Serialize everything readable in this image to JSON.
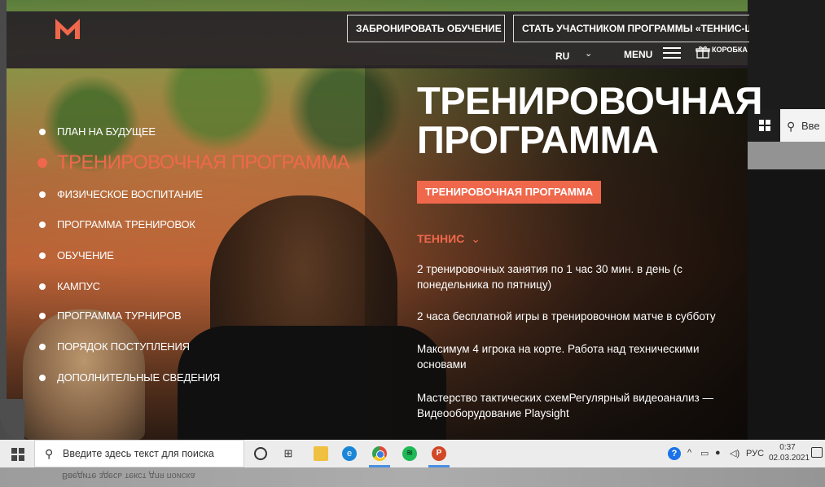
{
  "header": {
    "btn_book": "ЗАБРОНИРОВАТЬ ОБУЧЕНИЕ",
    "btn_member": "СТАТЬ УЧАСТНИКОМ ПРОГРАММЫ «ТЕННИС-ШК",
    "lang": "RU",
    "lang_chevron": "⌄",
    "menu": "MENU",
    "gift_label": "КОРОБКА"
  },
  "nav": {
    "items": [
      "ПЛАН НА БУДУЩЕЕ",
      "ТРЕНИРОВОЧНАЯ ПРОГРАММА",
      "ФИЗИЧЕСКОЕ ВОСПИТАНИЕ",
      "ПРОГРАММА ТРЕНИРОВОК",
      "ОБУЧЕНИЕ",
      "КАМПУС",
      "ПРОГРАММА ТУРНИРОВ",
      "ПОРЯДОК ПОСТУПЛЕНИЯ",
      "ДОПОЛНИТЕЛЬНЫЕ СВЕДЕНИЯ"
    ]
  },
  "content": {
    "title_line1": "ТРЕНИРОВОЧНАЯ",
    "title_line2": "ПРОГРАММА",
    "tag": "ТРЕНИРОВОЧНАЯ ПРОГРАММА",
    "section": "ТЕННИС",
    "section_chevron": "⌄",
    "paragraphs": [
      "2 тренировочных занятия по 1 час 30 мин. в день (с понедельника по пятницу)",
      "2 часа бесплатной игры в тренировочном матче в субботу",
      "Максимум 4 игрока на корте. Работа над техническими основами",
      "Мастерство тактических схемРегулярный видеоанализ — Видеооборудование Playsight"
    ]
  },
  "right_window": {
    "search_text": "Вве"
  },
  "taskbar": {
    "search_placeholder": "Введите здесь текст для поиска",
    "tray_lang": "РУС",
    "time": "0:37",
    "date": "02.03.2021",
    "edge_glyph": "e",
    "spotify_glyph": "≋",
    "ppt_glyph": "P",
    "help_glyph": "?"
  },
  "colors": {
    "accent": "#f0684c",
    "header_bg": "#231c26",
    "taskbar_bg": "#ececec"
  }
}
